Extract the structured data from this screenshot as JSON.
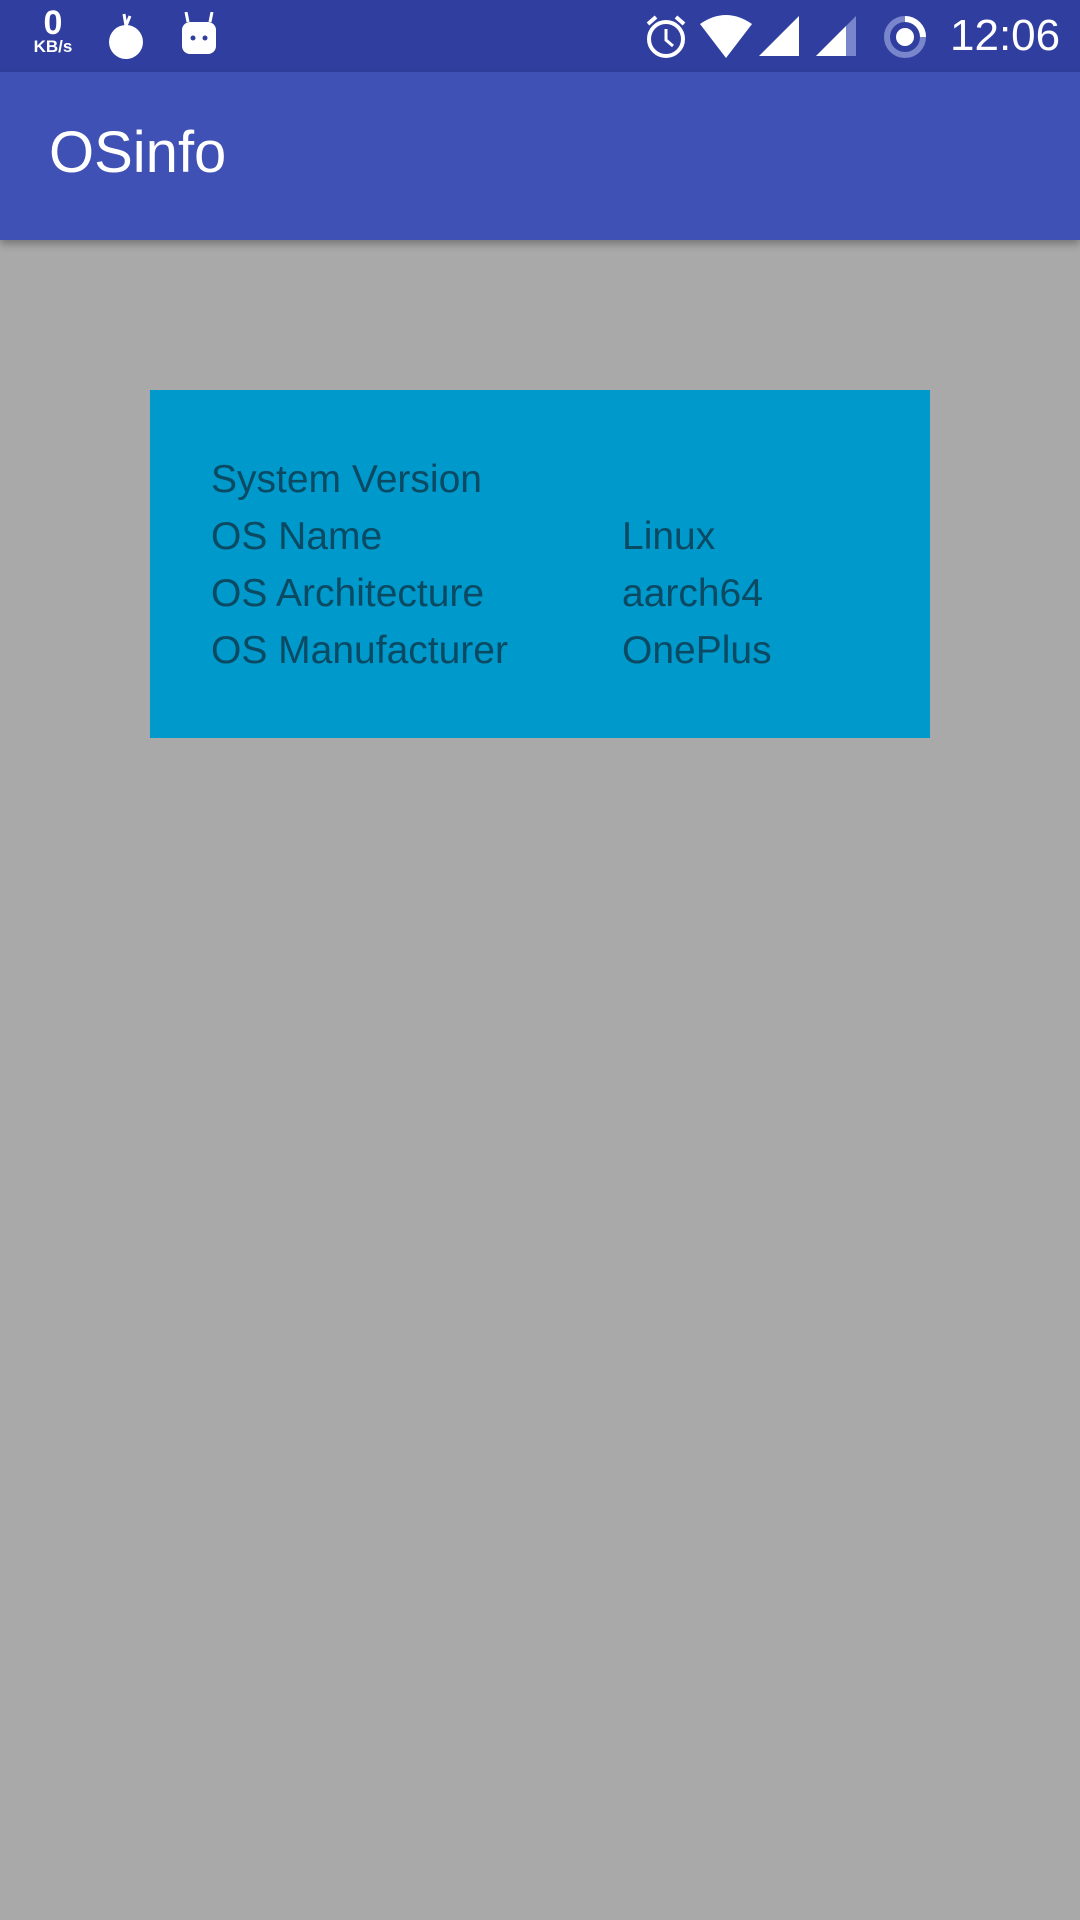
{
  "status_bar": {
    "net_speed_value": "0",
    "net_speed_unit": "KB/s",
    "time": "12:06",
    "icons": [
      "data-saver-icon",
      "android-icon",
      "alarm-icon",
      "wifi-icon",
      "signal-icon",
      "signal-icon-2",
      "battery-ring-icon"
    ]
  },
  "app_bar": {
    "title": "OSinfo"
  },
  "info": {
    "rows": [
      {
        "label": "System Version",
        "value": ""
      },
      {
        "label": "OS Name",
        "value": "Linux"
      },
      {
        "label": "OS Architecture",
        "value": "aarch64"
      },
      {
        "label": "OS Manufacturer",
        "value": "OnePlus"
      }
    ]
  },
  "colors": {
    "status_bar": "#303f9f",
    "app_bar": "#3f51b5",
    "card": "#0099cc",
    "background": "#a9a9a9",
    "text": "#0b4a63"
  }
}
